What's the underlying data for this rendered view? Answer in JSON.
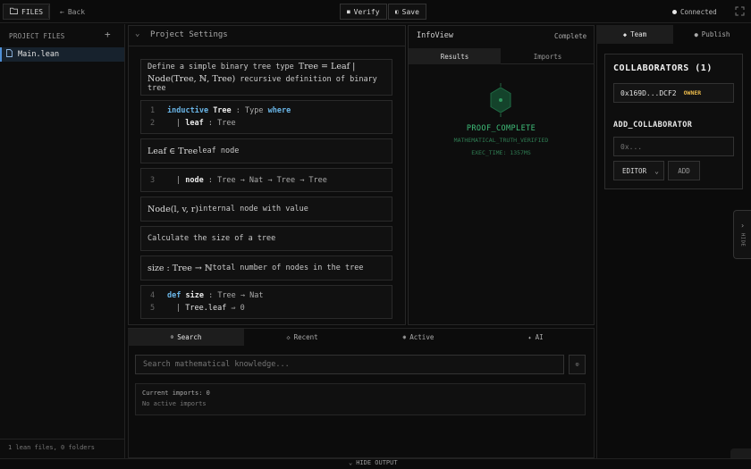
{
  "topbar": {
    "files_label": "FILES",
    "back_label": "Back",
    "verify_label": "Verify",
    "save_label": "Save",
    "connection_status": "Connected"
  },
  "sidebar": {
    "title": "PROJECT FILES",
    "add_symbol": "+",
    "files": [
      {
        "name": "Main.lean"
      }
    ],
    "footer": "1 lean files, 0 folders"
  },
  "editor": {
    "title": "Project Settings",
    "cells": [
      {
        "type": "text",
        "prefix": "Define a simple binary tree type ",
        "math1": "Tree = Leaf |",
        "math2": "Node(Tree, ℕ, Tree)",
        "suffix": " recursive definition of binary tree"
      },
      {
        "type": "code",
        "lines": [
          {
            "num": "1",
            "kw": "inductive",
            "name": "Tree",
            "rest": " : Type ",
            "kw2": "where"
          },
          {
            "num": "2",
            "bar": "| ",
            "name": "leaf",
            "rest": " : Tree"
          }
        ]
      },
      {
        "type": "text",
        "math": "Leaf ∈ Tree",
        "text": " leaf node"
      },
      {
        "type": "code",
        "lines": [
          {
            "num": "3",
            "bar": "| ",
            "name": "node",
            "rest": " : Tree → Nat → Tree → Tree"
          }
        ]
      },
      {
        "type": "text",
        "math": "Node(l, v, r)",
        "text": " internal node with value"
      },
      {
        "type": "text",
        "text": "Calculate the size of a tree"
      },
      {
        "type": "text",
        "math": "size : Tree → ℕ",
        "text": " total number of nodes in the tree"
      },
      {
        "type": "code",
        "lines": [
          {
            "num": "4",
            "kw": "def",
            "name": "size",
            "rest": " : Tree → Nat"
          },
          {
            "num": "5",
            "bar": "| ",
            "name": "Tree.leaf",
            "rest": " ⇒ 0"
          }
        ]
      }
    ]
  },
  "infoview": {
    "title": "InfoView",
    "status": "Complete",
    "tabs": [
      "Results",
      "Imports"
    ],
    "result_title": "PROOF_COMPLETE",
    "result_subtitle": "MATHEMATICAL_TRUTH_VERIFIED",
    "exec_time": "EXEC_TIME: 1357MS"
  },
  "right_panel": {
    "tabs": [
      "Team",
      "Publish"
    ],
    "collaborators_title": "COLLABORATORS (1)",
    "collaborators": [
      {
        "id": "0x169D...DCF2",
        "role": "OWNER"
      }
    ],
    "add_title": "ADD_COLLABORATOR",
    "input_placeholder": "0x...",
    "role_selected": "EDITOR",
    "add_label": "ADD",
    "hide_label": "HIDE"
  },
  "bottom": {
    "tabs": [
      "Search",
      "Recent",
      "Active",
      "AI"
    ],
    "search_placeholder": "Search mathematical knowledge...",
    "current_imports": "Current imports: 0",
    "no_active": "No active imports"
  },
  "statusbar": {
    "hide_output": "HIDE OUTPUT"
  },
  "colors": {
    "accent_green": "#3fbf7a",
    "owner_gold": "#e8b84a",
    "keyword_blue": "#6ab6e8",
    "selection": "#17222d"
  }
}
